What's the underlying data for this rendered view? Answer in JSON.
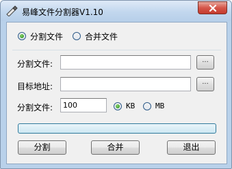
{
  "window": {
    "title": "易峰文件分割器V1.10"
  },
  "mode": {
    "split_label": "分割文件",
    "merge_label": "合并文件",
    "selected": "split"
  },
  "form": {
    "split_file_label": "分割文件:",
    "split_file_value": "",
    "target_label": "目标地址:",
    "target_value": "",
    "browse_label": "...",
    "size_label": "分割文件:",
    "size_value": "100",
    "unit_kb": "KB",
    "unit_mb": "MB",
    "unit_selected": "KB"
  },
  "progress": {
    "value": 0
  },
  "buttons": {
    "split": "分割",
    "merge": "合并",
    "exit": "退出"
  },
  "colors": {
    "titlebar": "#c2d7ee",
    "close_button": "#c43a2d",
    "client_bg": "#f0f0f0",
    "progress_border": "#2f7a9c"
  }
}
